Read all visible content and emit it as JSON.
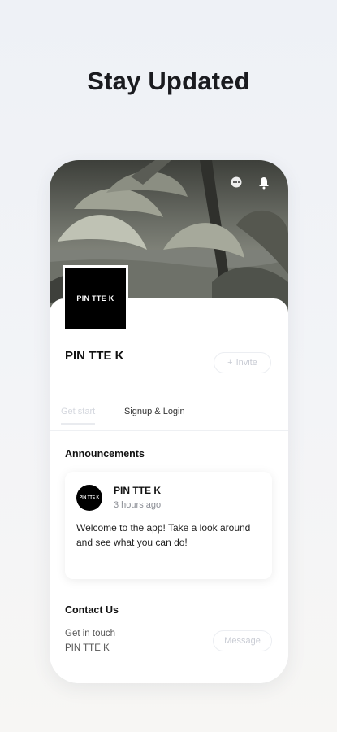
{
  "headline": "Stay Updated",
  "colors": {
    "background": "#eef1f6",
    "card": "#ffffff",
    "logo_bg": "#000000",
    "muted_button": "#c9ccd4"
  },
  "header": {
    "icons": [
      "more-icon",
      "bell-icon"
    ]
  },
  "site": {
    "logo_text": "PIN TTE K",
    "name": "PIN TTE K",
    "invite_label": "Invite"
  },
  "tabs": [
    {
      "label": "Get start",
      "active": true
    },
    {
      "label": "Signup & Login",
      "active": false
    }
  ],
  "announcements": {
    "title": "Announcements",
    "post": {
      "avatar_text": "PIN TTE K",
      "author": "PIN TTE K",
      "time": "3 hours ago",
      "body": "Welcome to the app! Take a look around and see what you can do!"
    }
  },
  "contact": {
    "title": "Contact Us",
    "line1": "Get in touch",
    "line2": "PIN TTE K",
    "message_label": "Message"
  }
}
